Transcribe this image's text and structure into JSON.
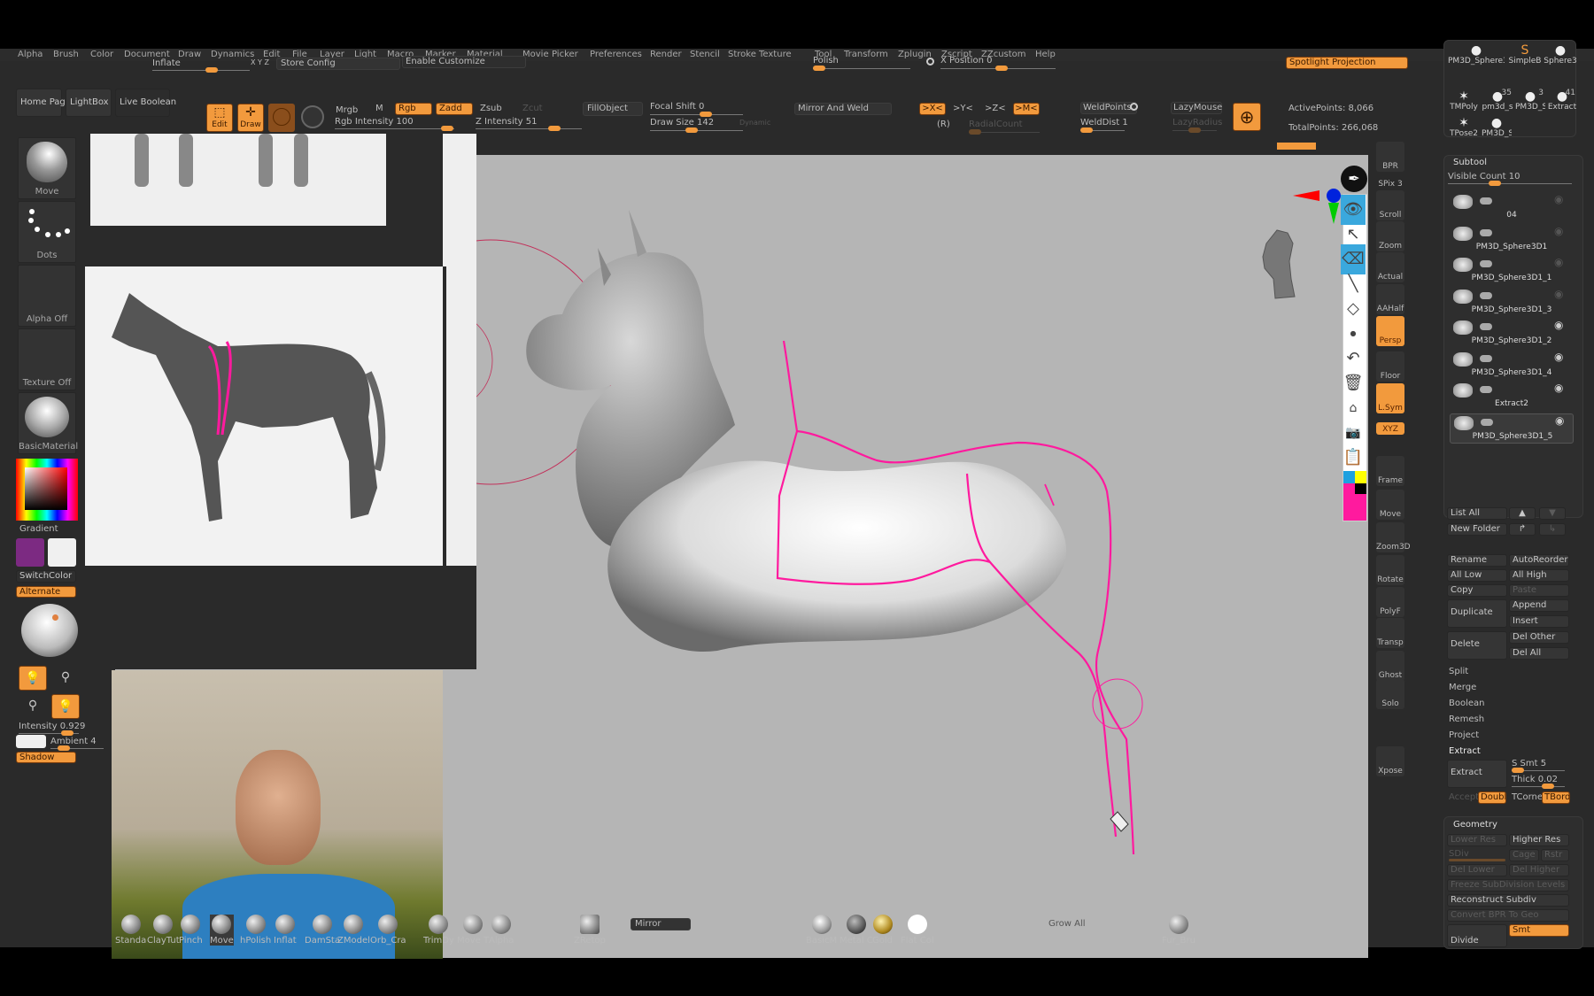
{
  "menu": [
    "Alpha",
    "Brush",
    "Color",
    "Document",
    "Draw",
    "Dynamics",
    "Edit",
    "File",
    "Layer",
    "Light",
    "Macro",
    "Marker",
    "Material",
    "Movie",
    "Picker",
    "Preferences",
    "Render",
    "Stencil",
    "Stroke",
    "Texture",
    "Tool",
    "Transform",
    "Zplugin",
    "Zscript",
    "ZZcustom",
    "Help"
  ],
  "top_row": {
    "inflate_label": "Inflate",
    "xyz_glyph": "X Y Z",
    "store_config": "Store Config",
    "enable_customize": "Enable Customize",
    "polish_label": "Polish",
    "x_position_label": "X Position 0",
    "spotlight_projection": "Spotlight Projection"
  },
  "toolbar": {
    "home_page": "Home Page",
    "lightbox": "LightBox",
    "live_boolean": "Live Boolean",
    "edit": "Edit",
    "draw": "Draw",
    "mrgb": "Mrgb",
    "m": "M",
    "rgb": "Rgb",
    "zadd": "Zadd",
    "zsub": "Zsub",
    "zcut": "Zcut",
    "rgb_intensity": "Rgb Intensity 100",
    "z_intensity": "Z Intensity 51",
    "fill_object": "FillObject",
    "focal_shift": "Focal Shift 0",
    "draw_size": "Draw Size 142",
    "dynamic": "Dynamic",
    "mirror_and_weld": "Mirror And Weld",
    "mx": ">X<",
    "my": ">Y<",
    "mz": ">Z<",
    "mm": ">M<",
    "r": "(R)",
    "radial_count": "RadialCount",
    "weld_points": "WeldPoints",
    "weld_dist": "WeldDist 1",
    "lazy_mouse": "LazyMouse",
    "lazy_radius": "LazyRadius",
    "active_points": "ActivePoints: 8,066",
    "total_points": "TotalPoints: 266,068"
  },
  "tool_palette": [
    {
      "label": "PM3D_Sphere3"
    },
    {
      "label": "SimpleB"
    },
    {
      "label": "Sphere3"
    },
    {
      "label": "TMPoly"
    },
    {
      "label": "pm3d_s",
      "count": "35"
    },
    {
      "label": "PM3D_S",
      "count": "3"
    },
    {
      "label": "Extract",
      "count": "41"
    },
    {
      "label": "TPose2"
    },
    {
      "label": "PM3D_S"
    }
  ],
  "left_shelf": {
    "brush": "Move",
    "stroke": "Dots",
    "alpha": "Alpha Off",
    "texture": "Texture Off",
    "material": "BasicMaterial",
    "gradient": "Gradient",
    "switch_color": "SwitchColor",
    "alternate": "Alternate",
    "intensity": "Intensity 0.929",
    "ambient": "Ambient 4",
    "shadow": "Shadow",
    "main_color": "#7c2a82",
    "secondary_color": "#f0f0f0"
  },
  "right_shelf": [
    {
      "label": "BPR"
    },
    {
      "label": "SPix 3"
    },
    {
      "label": "Scroll"
    },
    {
      "label": "Zoom"
    },
    {
      "label": "Actual"
    },
    {
      "label": "AAHalf"
    },
    {
      "label": "Persp",
      "on": true
    },
    {
      "label": "Floor"
    },
    {
      "label": "L.Sym",
      "on": true
    },
    {
      "label": "XYZ",
      "on": true
    },
    {
      "label": "Frame"
    },
    {
      "label": "Move"
    },
    {
      "label": "Zoom3D"
    },
    {
      "label": "Rotate"
    },
    {
      "label": "PolyF"
    },
    {
      "label": "Transp"
    },
    {
      "label": "Ghost"
    },
    {
      "label": "Solo"
    },
    {
      "label": "Xpose"
    }
  ],
  "subtool": {
    "title": "Subtool",
    "visible_count": "Visible Count 10",
    "items": [
      "04",
      "PM3D_Sphere3D1",
      "PM3D_Sphere3D1_1",
      "PM3D_Sphere3D1_3",
      "PM3D_Sphere3D1_2",
      "PM3D_Sphere3D1_4",
      "Extract2",
      "PM3D_Sphere3D1_5"
    ],
    "list_all": "List All",
    "new_folder": "New Folder",
    "rename": "Rename",
    "auto_reorder": "AutoReorder",
    "all_low": "All Low",
    "all_high": "All High",
    "copy": "Copy",
    "paste": "Paste",
    "duplicate": "Duplicate",
    "append": "Append",
    "insert": "Insert",
    "delete": "Delete",
    "del_other": "Del Other",
    "del_all": "Del All",
    "split": "Split",
    "merge": "Merge",
    "boolean": "Boolean",
    "remesh": "Remesh",
    "project": "Project",
    "extract_section": "Extract",
    "extract_btn": "Extract",
    "s_smt": "S Smt 5",
    "thick": "Thick 0.02",
    "accept": "Accept",
    "double": "Double",
    "tcorne": "TCorne",
    "tbord": "TBord"
  },
  "geometry": {
    "title": "Geometry",
    "lower_res": "Lower Res",
    "higher_res": "Higher Res",
    "sdiv": "SDiv",
    "cage": "Cage",
    "rstr": "Rstr",
    "del_lower": "Del Lower",
    "del_higher": "Del Higher",
    "freeze": "Freeze SubDivision Levels",
    "reconstruct": "Reconstruct Subdiv",
    "convert_bpr": "Convert BPR To Geo",
    "divide": "Divide",
    "smt": "Smt"
  },
  "bottom_shelf": {
    "brushes": [
      "Standa",
      "ClayTut",
      "Pinch",
      "Move",
      "hPolish",
      "Inflat",
      "DamSta",
      "ZModel",
      "Orb_Cra",
      "TrimDy",
      "Move T",
      "Alpha"
    ],
    "zretop": "ZRetop",
    "mirror": "Mirror",
    "materials": [
      "BasicM",
      "Metal C",
      "Gold",
      "Flat Col"
    ],
    "grow_all": "Grow All",
    "fur_brush": "Fur_Bru"
  },
  "colors": {
    "accent": "#f29a3d",
    "stroke_pink": "#ff1a9e",
    "viewport_bg": "#b5b5b5"
  }
}
